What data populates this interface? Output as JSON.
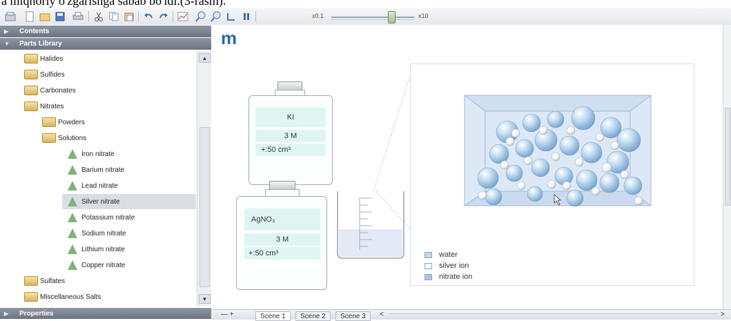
{
  "caption": "a miqnoriy o'zgarishga sabab bo'ldi.(3-rasm).",
  "toolbar": {
    "buttons": [
      "library-icon",
      "new-icon",
      "open-icon",
      "save-icon",
      "print-icon",
      "cut-icon",
      "copy-icon",
      "paste-icon",
      "undo-icon",
      "redo-icon",
      "chart-icon",
      "zoom-in-icon",
      "zoom-out-icon",
      "fit-icon",
      "pause-icon"
    ],
    "zoom_min": "x0.1",
    "zoom_max": "x10"
  },
  "sidebar": {
    "contents_label": "Contents",
    "parts_library_label": "Parts Library",
    "properties_label": "Properties",
    "items": [
      {
        "label": "Halides",
        "level": 1,
        "icon": "folder-icon"
      },
      {
        "label": "Sulfides",
        "level": 1,
        "icon": "folder-icon"
      },
      {
        "label": "Carbonates",
        "level": 1,
        "icon": "folder-icon"
      },
      {
        "label": "Nitrates",
        "level": 1,
        "icon": "folder-icon"
      },
      {
        "label": "Powders",
        "level": 2,
        "icon": "folder-icon"
      },
      {
        "label": "Solutions",
        "level": 2,
        "icon": "folder-icon"
      },
      {
        "label": "Iron nitrate",
        "level": 3,
        "icon": "flask-icon"
      },
      {
        "label": "Barium nitrate",
        "level": 3,
        "icon": "flask-icon"
      },
      {
        "label": "Lead nitrate",
        "level": 3,
        "icon": "flask-icon"
      },
      {
        "label": "Silver nitrate",
        "level": 3,
        "icon": "flask-icon",
        "selected": true
      },
      {
        "label": "Potassium nitrate",
        "level": 3,
        "icon": "flask-icon"
      },
      {
        "label": "Sodium nitrate",
        "level": 3,
        "icon": "flask-icon"
      },
      {
        "label": "Lithium nitrate",
        "level": 3,
        "icon": "flask-icon"
      },
      {
        "label": "Copper nitrate",
        "level": 3,
        "icon": "flask-icon"
      },
      {
        "label": "Sulfates",
        "level": 1,
        "icon": "folder-icon"
      },
      {
        "label": "Miscellaneous Salts",
        "level": 1,
        "icon": "folder-icon"
      }
    ]
  },
  "main": {
    "logo": "m",
    "bottle_ki": {
      "formula": "KI",
      "concentration": "3 M",
      "volume": "+:50 cm³"
    },
    "bottle_agno3": {
      "formula": "AgNO₃",
      "concentration": "3 M",
      "volume": "+:50 cm³"
    },
    "legend": [
      {
        "label": "water",
        "color": "#c4d6ea"
      },
      {
        "label": "silver ion",
        "color": "#ffffff"
      },
      {
        "label": "nitrate ion",
        "color": "#a9c5e3"
      }
    ]
  },
  "statusbar": {
    "nav": "— +",
    "scenes": [
      "Scene 1",
      "Scene 2",
      "Scene 3"
    ],
    "prev": "<",
    "next": ">"
  }
}
